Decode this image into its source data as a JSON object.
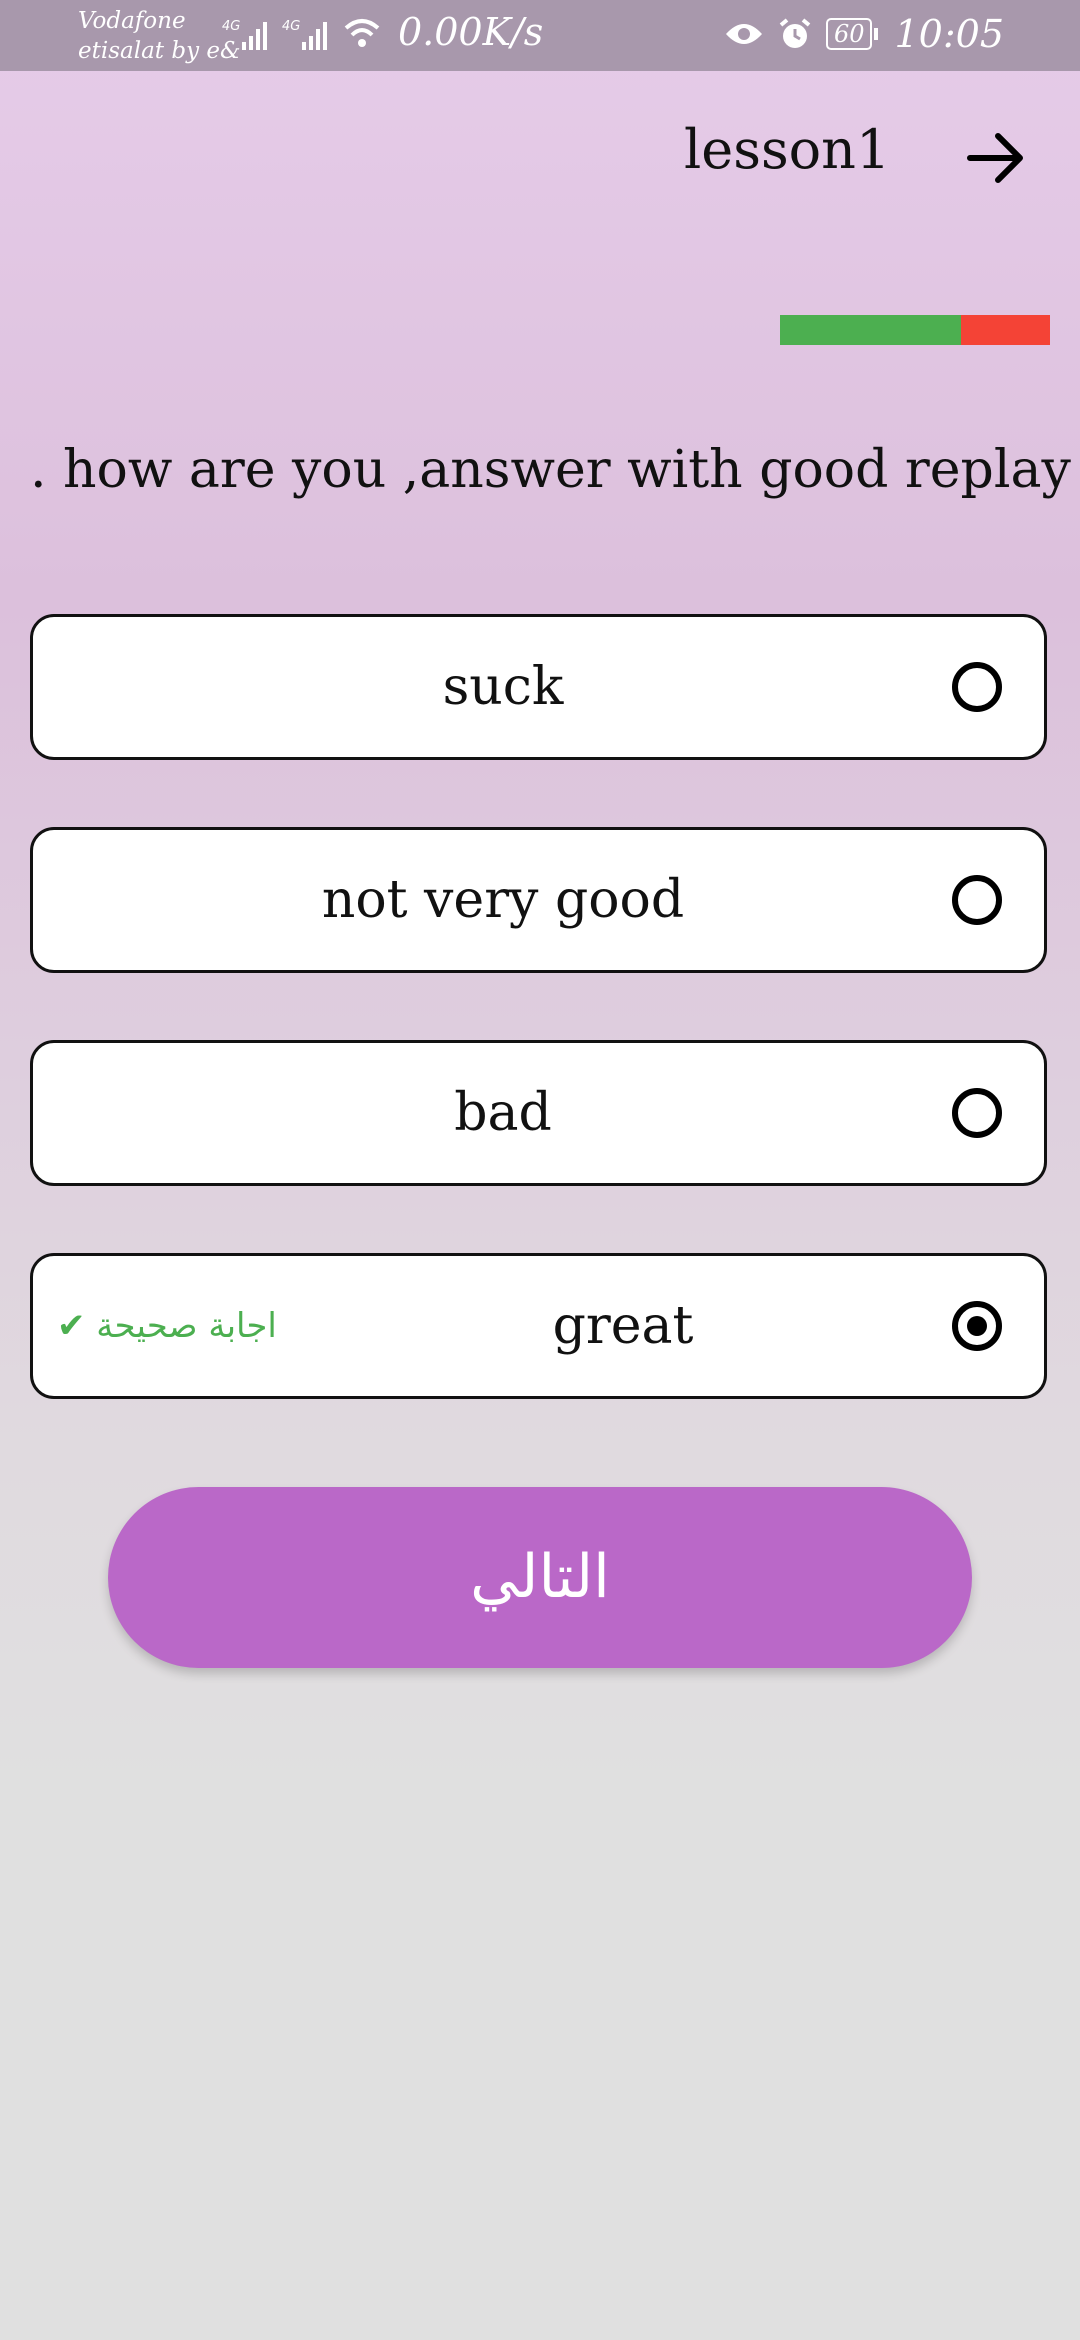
{
  "status_bar": {
    "carrier_line1": "Vodafone",
    "carrier_line2": "etisalat by e&",
    "network1": "4G",
    "network2": "4G",
    "net_speed": "0.00K/s",
    "battery": "60",
    "time": "10:05",
    "icons": [
      "signal-icon",
      "wifi-icon",
      "eye-icon",
      "alarm-icon",
      "battery-icon"
    ]
  },
  "header": {
    "title": "lesson1",
    "back_icon": "arrow-right-icon"
  },
  "progress": {
    "fraction_complete": 0.67,
    "complete_color": "#4caf50",
    "remaining_color": "#f44336"
  },
  "question": ". how are you ,answer with good replay",
  "options": [
    {
      "label": "suck",
      "selected": false
    },
    {
      "label": "not very good",
      "selected": false
    },
    {
      "label": "bad",
      "selected": false
    },
    {
      "label": "great",
      "selected": true,
      "feedback": "اجابة صحيحة ✔"
    }
  ],
  "feedback_color": "#4caf50",
  "next_button": {
    "label": "التالي",
    "color": "#ba68c8"
  }
}
